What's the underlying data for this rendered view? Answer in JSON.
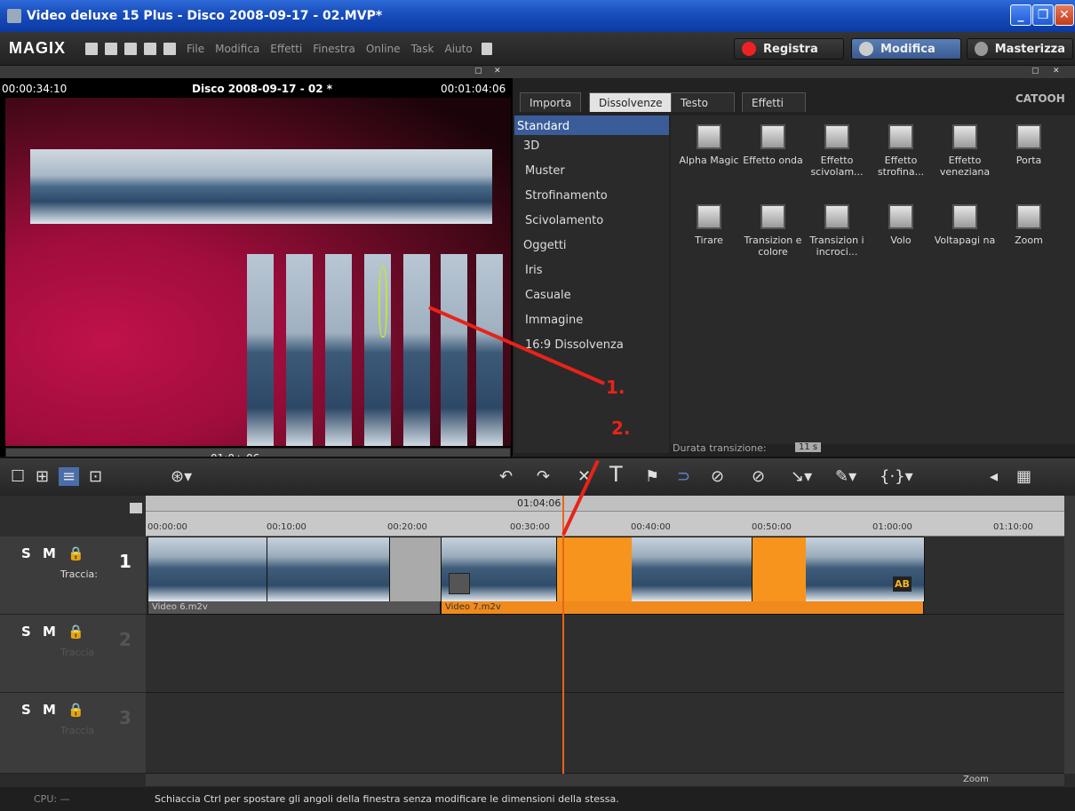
{
  "window": {
    "title": "Video deluxe 15 Plus - Disco 2008-09-17 - 02.MVP*"
  },
  "menubar": {
    "logo": "MAGIX",
    "items": [
      "File",
      "Modifica",
      "Effetti",
      "Finestra",
      "Online",
      "Task",
      "Aiuto"
    ],
    "modes": {
      "record": "Registra",
      "edit": "Modifica",
      "burn": "Masterizza"
    }
  },
  "preview": {
    "time_left": "00:00:34:10",
    "title": "Disco 2008-09-17 - 02 *",
    "time_right": "00:01:04:06",
    "scrub_time": "01:0▲.06"
  },
  "effects": {
    "tabs": [
      "Importa",
      "Dissolvenze",
      "Testo",
      "Effetti"
    ],
    "active_tab": "Dissolvenze",
    "brand": "CATOOH",
    "categories": [
      "Standard",
      "3D",
      "Muster",
      "Strofinamento",
      "Scivolamento",
      "Oggetti",
      "Iris",
      "Casuale",
      "Immagine",
      "16:9 Dissolvenza"
    ],
    "transitions_row1": [
      "Alpha Magic",
      "Effetto onda",
      "Effetto scivolam...",
      "Effetto strofina...",
      "Effetto veneziana",
      "Porta"
    ],
    "transitions_row2": [
      "Tirare",
      "Transizion e colore",
      "Transizion i incroci...",
      "Volo",
      "Voltapagi na",
      "Zoom"
    ],
    "duration_label": "Durata transizione:",
    "duration_value": "11 s"
  },
  "timeline": {
    "marker": "01:04:06",
    "ruler": [
      "00:00:00",
      "00:10:00",
      "00:20:00",
      "00:30:00",
      "00:40:00",
      "00:50:00",
      "01:00:00",
      "01:10:00"
    ],
    "tracks": [
      {
        "controls": "S M 🔒",
        "number": "1",
        "label": "Traccia:"
      },
      {
        "controls": "S M 🔒",
        "number": "2",
        "label": "Traccia"
      },
      {
        "controls": "S M 🔒",
        "number": "3",
        "label": "Traccia"
      }
    ],
    "clips": {
      "clip1": "Video 6.m2v",
      "clip2": "Video 7.m2v",
      "ab_badge": "AB"
    },
    "zoom_label": "Zoom"
  },
  "annotations": {
    "callout1": "1.",
    "callout2": "2."
  },
  "status": {
    "cpu": "CPU: —",
    "message": "Schiaccia Ctrl per spostare gli angoli della finestra senza modificare le dimensioni della stessa."
  }
}
